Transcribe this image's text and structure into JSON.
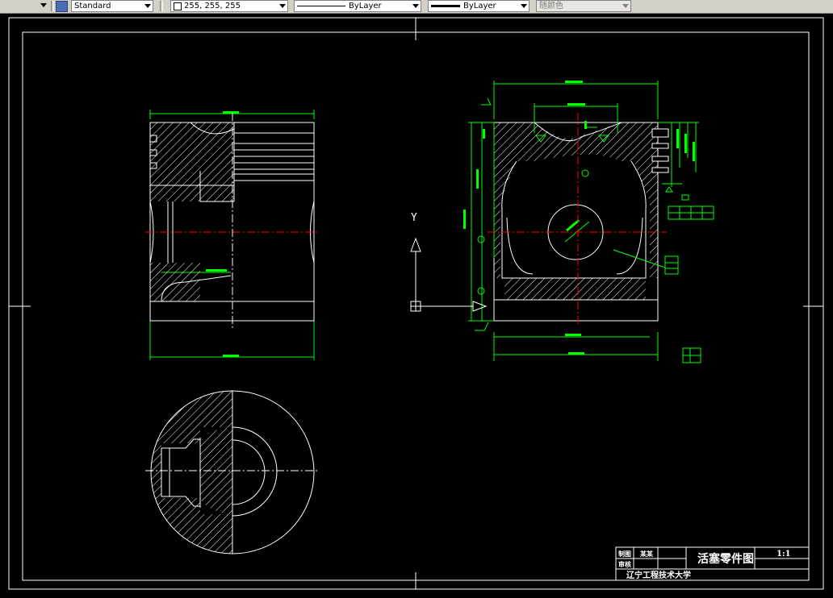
{
  "toolbar": {
    "text_style": "Standard",
    "color_value": "255, 255, 255",
    "linetype": "ByLayer",
    "lineweight": "ByLayer",
    "plot_style": "随颜色"
  },
  "title_block": {
    "drawing_title": "活塞零件图",
    "scale": "1:1",
    "school": "辽宁工程技术大学",
    "row1_label": "制图",
    "row1_value": "某某",
    "row2_label": "审核"
  },
  "ucs": {
    "y_label": "Y"
  },
  "colors": {
    "background": "#000000",
    "outline": "#ffffff",
    "dimension": "#00ff00",
    "centerline": "#ff0000",
    "toolbar": "#d4d0c8"
  }
}
